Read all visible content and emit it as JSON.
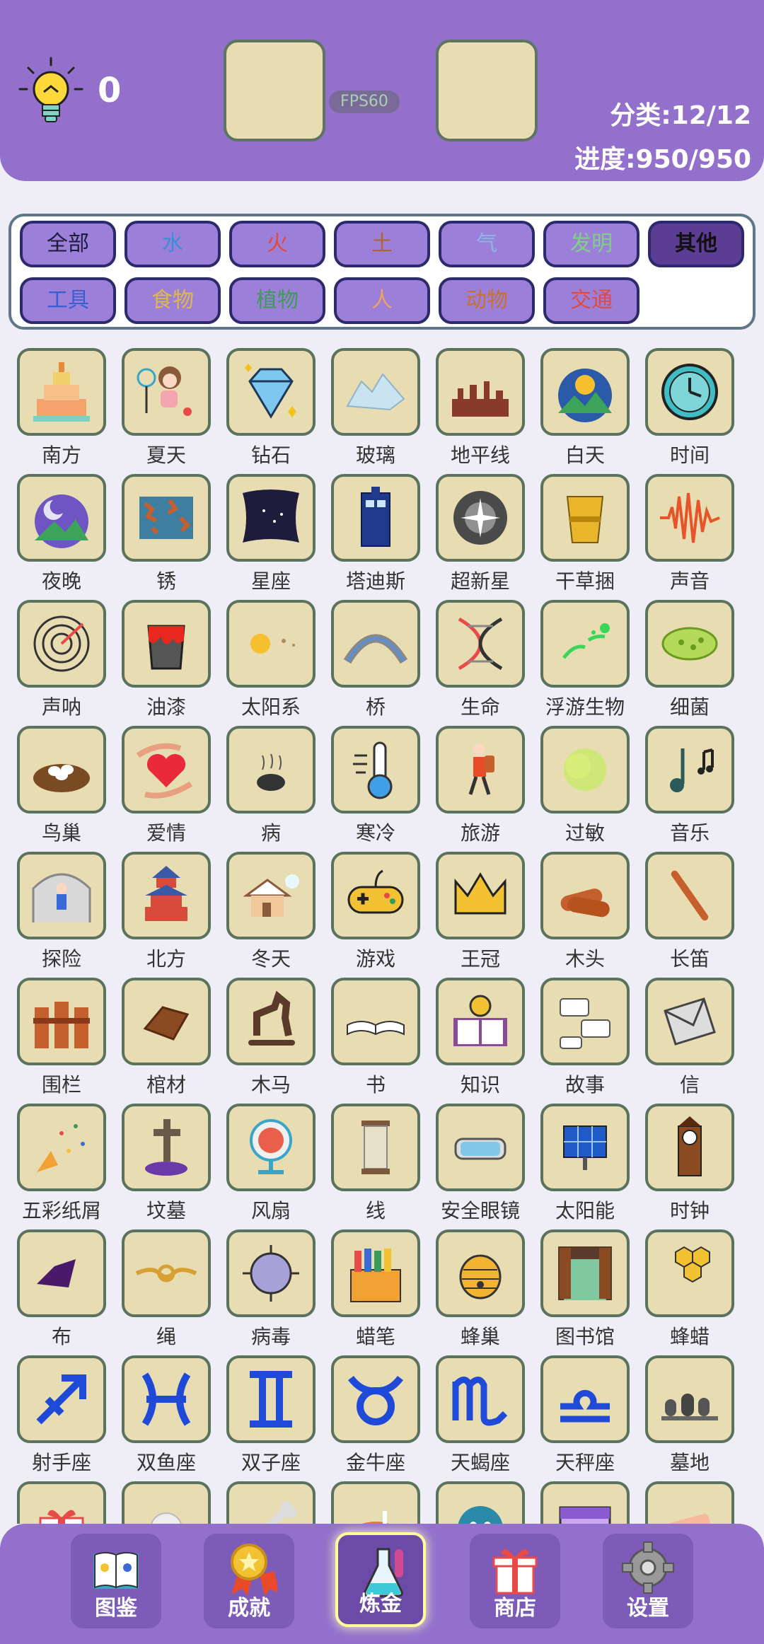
{
  "header": {
    "hint_count": "0",
    "fps": "FPS60",
    "category_stat": "分类:12/12",
    "progress_stat": "进度:950/950"
  },
  "filters": [
    {
      "label": "全部",
      "color": "#1b1b3a",
      "active": false
    },
    {
      "label": "水",
      "color": "#3b8fd6",
      "active": false
    },
    {
      "label": "火",
      "color": "#e24a3b",
      "active": false
    },
    {
      "label": "土",
      "color": "#b0642e",
      "active": false
    },
    {
      "label": "气",
      "color": "#8fb3e6",
      "active": false
    },
    {
      "label": "发明",
      "color": "#7fcf86",
      "active": false
    },
    {
      "label": "其他",
      "color": "#111111",
      "active": true
    },
    {
      "label": "工具",
      "color": "#3a5ed0",
      "active": false
    },
    {
      "label": "食物",
      "color": "#e0b84a",
      "active": false
    },
    {
      "label": "植物",
      "color": "#3f9a5c",
      "active": false
    },
    {
      "label": "人",
      "color": "#f0a060",
      "active": false
    },
    {
      "label": "动物",
      "color": "#c9702e",
      "active": false
    },
    {
      "label": "交通",
      "color": "#e24a3b",
      "active": false
    }
  ],
  "items": [
    {
      "name": "南方",
      "icon": "temple-icon"
    },
    {
      "name": "夏天",
      "icon": "summer-girl-icon"
    },
    {
      "name": "钻石",
      "icon": "diamond-icon"
    },
    {
      "name": "玻璃",
      "icon": "glass-icon"
    },
    {
      "name": "地平线",
      "icon": "skyline-icon"
    },
    {
      "name": "白天",
      "icon": "daytime-icon"
    },
    {
      "name": "时间",
      "icon": "clock-icon"
    },
    {
      "name": "夜晚",
      "icon": "night-icon"
    },
    {
      "name": "锈",
      "icon": "rust-icon"
    },
    {
      "name": "星座",
      "icon": "constellation-icon"
    },
    {
      "name": "塔迪斯",
      "icon": "tardis-icon"
    },
    {
      "name": "超新星",
      "icon": "supernova-icon"
    },
    {
      "name": "干草捆",
      "icon": "hay-bale-icon"
    },
    {
      "name": "声音",
      "icon": "soundwave-icon"
    },
    {
      "name": "声呐",
      "icon": "sonar-icon"
    },
    {
      "name": "油漆",
      "icon": "paint-bucket-icon"
    },
    {
      "name": "太阳系",
      "icon": "solar-system-icon"
    },
    {
      "name": "桥",
      "icon": "bridge-icon"
    },
    {
      "name": "生命",
      "icon": "dna-icon"
    },
    {
      "name": "浮游生物",
      "icon": "plankton-icon"
    },
    {
      "name": "细菌",
      "icon": "bacteria-icon"
    },
    {
      "name": "鸟巢",
      "icon": "nest-icon"
    },
    {
      "name": "爱情",
      "icon": "heart-hands-icon"
    },
    {
      "name": "病",
      "icon": "sick-icon"
    },
    {
      "name": "寒冷",
      "icon": "thermometer-icon"
    },
    {
      "name": "旅游",
      "icon": "traveler-icon"
    },
    {
      "name": "过敏",
      "icon": "allergy-icon"
    },
    {
      "name": "音乐",
      "icon": "music-note-icon"
    },
    {
      "name": "探险",
      "icon": "explorer-icon"
    },
    {
      "name": "北方",
      "icon": "pagoda-icon"
    },
    {
      "name": "冬天",
      "icon": "winter-house-icon"
    },
    {
      "name": "游戏",
      "icon": "gamepad-icon"
    },
    {
      "name": "王冠",
      "icon": "crown-icon"
    },
    {
      "name": "木头",
      "icon": "logs-icon"
    },
    {
      "name": "长笛",
      "icon": "flute-icon"
    },
    {
      "name": "围栏",
      "icon": "fence-icon"
    },
    {
      "name": "棺材",
      "icon": "coffin-icon"
    },
    {
      "name": "木马",
      "icon": "wooden-horse-icon"
    },
    {
      "name": "书",
      "icon": "book-icon"
    },
    {
      "name": "知识",
      "icon": "knowledge-icon"
    },
    {
      "name": "故事",
      "icon": "speech-bubbles-icon"
    },
    {
      "name": "信",
      "icon": "envelope-icon"
    },
    {
      "name": "五彩纸屑",
      "icon": "confetti-icon"
    },
    {
      "name": "坟墓",
      "icon": "grave-icon"
    },
    {
      "name": "风扇",
      "icon": "fan-icon"
    },
    {
      "name": "线",
      "icon": "thread-spool-icon"
    },
    {
      "name": "安全眼镜",
      "icon": "goggles-icon"
    },
    {
      "name": "太阳能",
      "icon": "solar-panel-icon"
    },
    {
      "name": "时钟",
      "icon": "clock-tower-icon"
    },
    {
      "name": "布",
      "icon": "cloth-icon"
    },
    {
      "name": "绳",
      "icon": "rope-icon"
    },
    {
      "name": "病毒",
      "icon": "virus-icon"
    },
    {
      "name": "蜡笔",
      "icon": "crayons-icon"
    },
    {
      "name": "蜂巢",
      "icon": "beehive-icon"
    },
    {
      "name": "图书馆",
      "icon": "library-icon"
    },
    {
      "name": "蜂蜡",
      "icon": "honeycomb-icon"
    },
    {
      "name": "射手座",
      "icon": "sagittarius-icon"
    },
    {
      "name": "双鱼座",
      "icon": "pisces-icon"
    },
    {
      "name": "双子座",
      "icon": "gemini-icon"
    },
    {
      "name": "金牛座",
      "icon": "taurus-icon"
    },
    {
      "name": "天蝎座",
      "icon": "scorpio-icon"
    },
    {
      "name": "天秤座",
      "icon": "libra-icon"
    },
    {
      "name": "墓地",
      "icon": "graveyard-icon"
    },
    {
      "name": "",
      "icon": "gift-icon"
    },
    {
      "name": "",
      "icon": "dandelion-icon"
    },
    {
      "name": "",
      "icon": "bone-icon"
    },
    {
      "name": "",
      "icon": "roast-icon"
    },
    {
      "name": "",
      "icon": "blue-creature-icon"
    },
    {
      "name": "",
      "icon": "calendar-icon"
    },
    {
      "name": "",
      "icon": "eraser-icon"
    }
  ],
  "nav": [
    {
      "label": "图鉴",
      "icon": "encyclopedia-icon",
      "active": false
    },
    {
      "label": "成就",
      "icon": "medal-icon",
      "active": false
    },
    {
      "label": "炼金",
      "icon": "flask-icon",
      "active": true
    },
    {
      "label": "商店",
      "icon": "gift-box-icon",
      "active": false
    },
    {
      "label": "设置",
      "icon": "gear-icon",
      "active": false
    }
  ]
}
